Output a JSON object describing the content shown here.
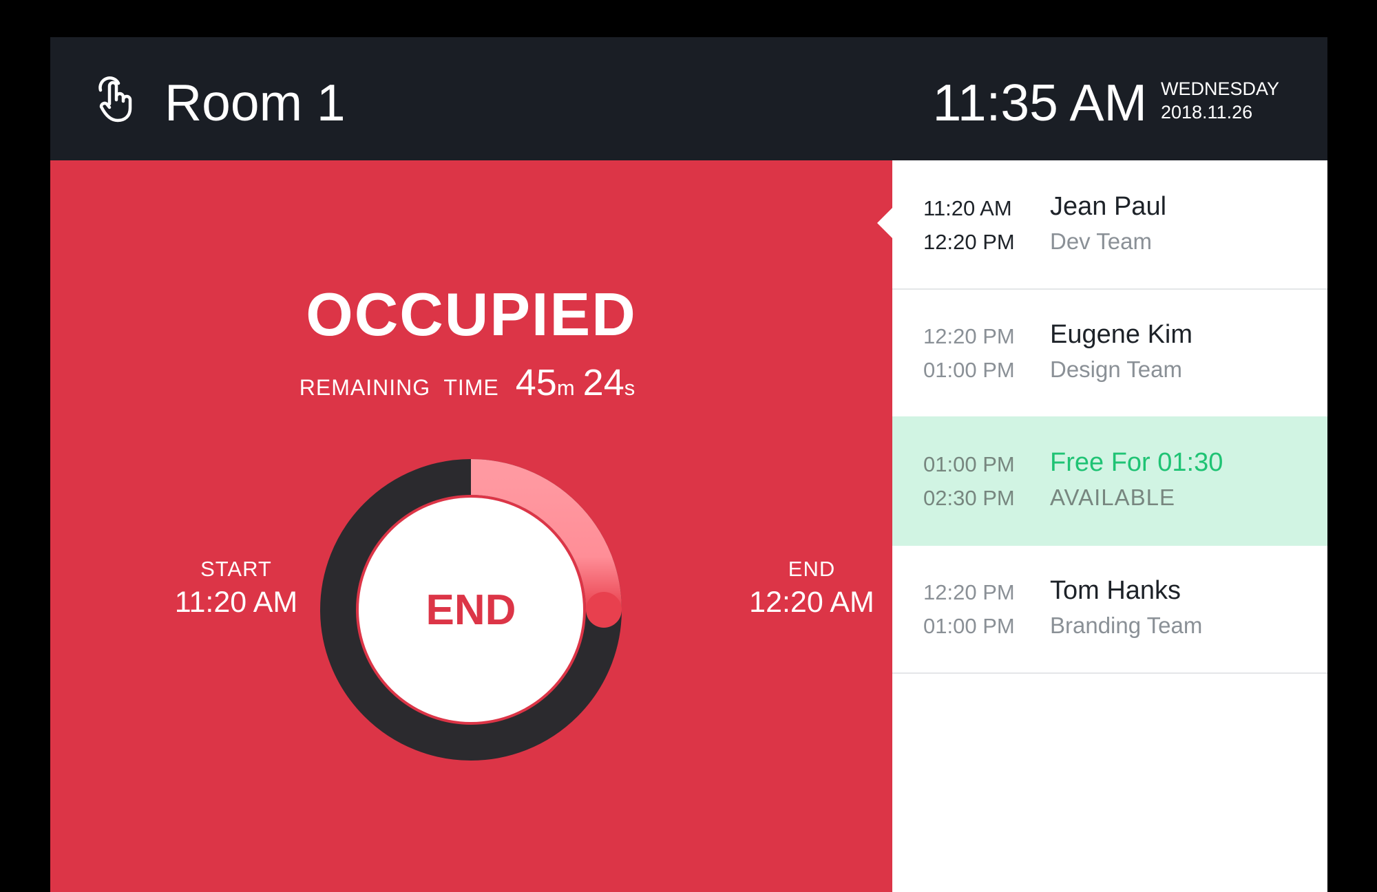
{
  "header": {
    "room_name": "Room 1",
    "time": "11:35 AM",
    "day": "WEDNESDAY",
    "date": "2018.11.26",
    "icon": "hand-pointer-icon"
  },
  "status": {
    "label": "OCCUPIED",
    "remaining_label": "REMAINING  TIME",
    "remaining_minutes": "45",
    "minutes_unit": "m",
    "remaining_seconds": "24",
    "seconds_unit": "s",
    "start_label": "START",
    "start_time": "11:20 AM",
    "end_label": "END",
    "end_time": "12:20 AM",
    "end_button_label": "END",
    "progress_fraction": 0.25
  },
  "schedule": [
    {
      "start": "11:20 AM",
      "end": "12:20 PM",
      "name": "Jean Paul",
      "team": "Dev Team"
    },
    {
      "start": "12:20 PM",
      "end": "01:00 PM",
      "name": "Eugene Kim",
      "team": "Design Team"
    },
    {
      "start": "01:00 PM",
      "end": "02:30 PM",
      "name": "Free For 01:30",
      "team": "AVAILABLE"
    },
    {
      "start": "12:20 PM",
      "end": "01:00 PM",
      "name": "Tom Hanks",
      "team": "Branding Team"
    }
  ],
  "colors": {
    "occupied": "#dc3547",
    "header": "#1a1e25",
    "available_bg": "#d1f4e3",
    "available_text": "#1fc374",
    "progress": "#ff8e97"
  }
}
